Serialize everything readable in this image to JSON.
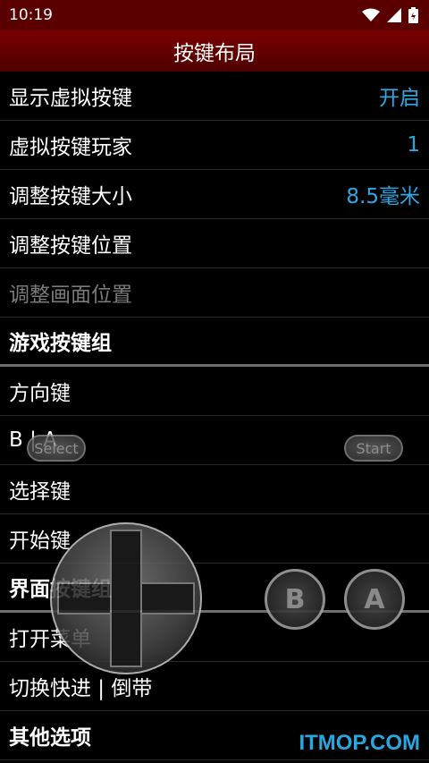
{
  "status": {
    "time": "10:19"
  },
  "header": {
    "title": "按键布局"
  },
  "settings": [
    {
      "label": "显示虚拟按键",
      "value": "开启"
    },
    {
      "label": "虚拟按键玩家",
      "value": "1"
    },
    {
      "label": "调整按键大小",
      "value": "8.5毫米"
    },
    {
      "label": "调整按键位置"
    },
    {
      "label": "调整画面位置"
    }
  ],
  "groups": {
    "game": "游戏按键组",
    "ui": "界面按键组",
    "other": "其他选项"
  },
  "game_items": [
    "方向键",
    "B | A",
    "选择键",
    "开始键"
  ],
  "ui_items": [
    "打开菜单",
    "切换快进 | 倒带"
  ],
  "overlay": {
    "select": "Select",
    "start": "Start",
    "b": "B",
    "a": "A"
  },
  "watermark": "ITMOP.COM",
  "colors": {
    "header": "#7a0000",
    "value": "#2aa8e8",
    "disabled": "#7a7a7a"
  }
}
